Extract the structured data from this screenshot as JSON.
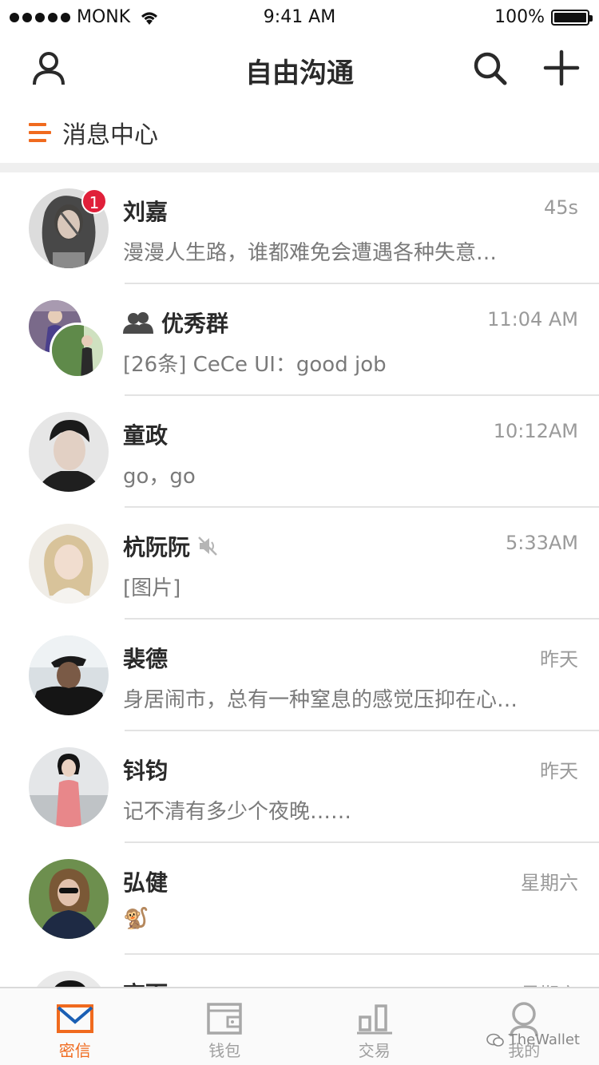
{
  "status_bar": {
    "carrier": "MONK",
    "time": "9:41 AM",
    "battery": "100%"
  },
  "nav": {
    "title": "自由沟通"
  },
  "section": {
    "title": "消息中心"
  },
  "chats": [
    {
      "name": "刘嘉",
      "time": "45s",
      "preview": "漫漫人生路，谁都难免会遭遇各种失意…",
      "badge": "1"
    },
    {
      "name": "优秀群",
      "time": "11:04 AM",
      "preview": "[26条]  CeCe UI：good job"
    },
    {
      "name": "童政",
      "time": "10:12AM",
      "preview": "go，go"
    },
    {
      "name": "杭阮阮",
      "time": "5:33AM",
      "preview": "[图片]"
    },
    {
      "name": "裴德",
      "time": "昨天",
      "preview": "身居闹市，总有一种窒息的感觉压抑在心…"
    },
    {
      "name": "钭钧",
      "time": "昨天",
      "preview": "记不清有多少个夜晚……"
    },
    {
      "name": "弘健",
      "time": "星期六",
      "preview": "🐒"
    },
    {
      "name": "高而",
      "time": "星期六",
      "preview": ""
    }
  ],
  "tabs": [
    {
      "label": "密信",
      "icon": "mail-icon"
    },
    {
      "label": "钱包",
      "icon": "wallet-icon"
    },
    {
      "label": "交易",
      "icon": "chart-icon"
    },
    {
      "label": "我的",
      "icon": "profile-icon"
    }
  ],
  "watermark": "TheWallet",
  "colors": {
    "accent": "#f06a1e",
    "badge": "#e0203a",
    "text_primary": "#2a2a2a",
    "text_secondary": "#7a7a7a"
  }
}
